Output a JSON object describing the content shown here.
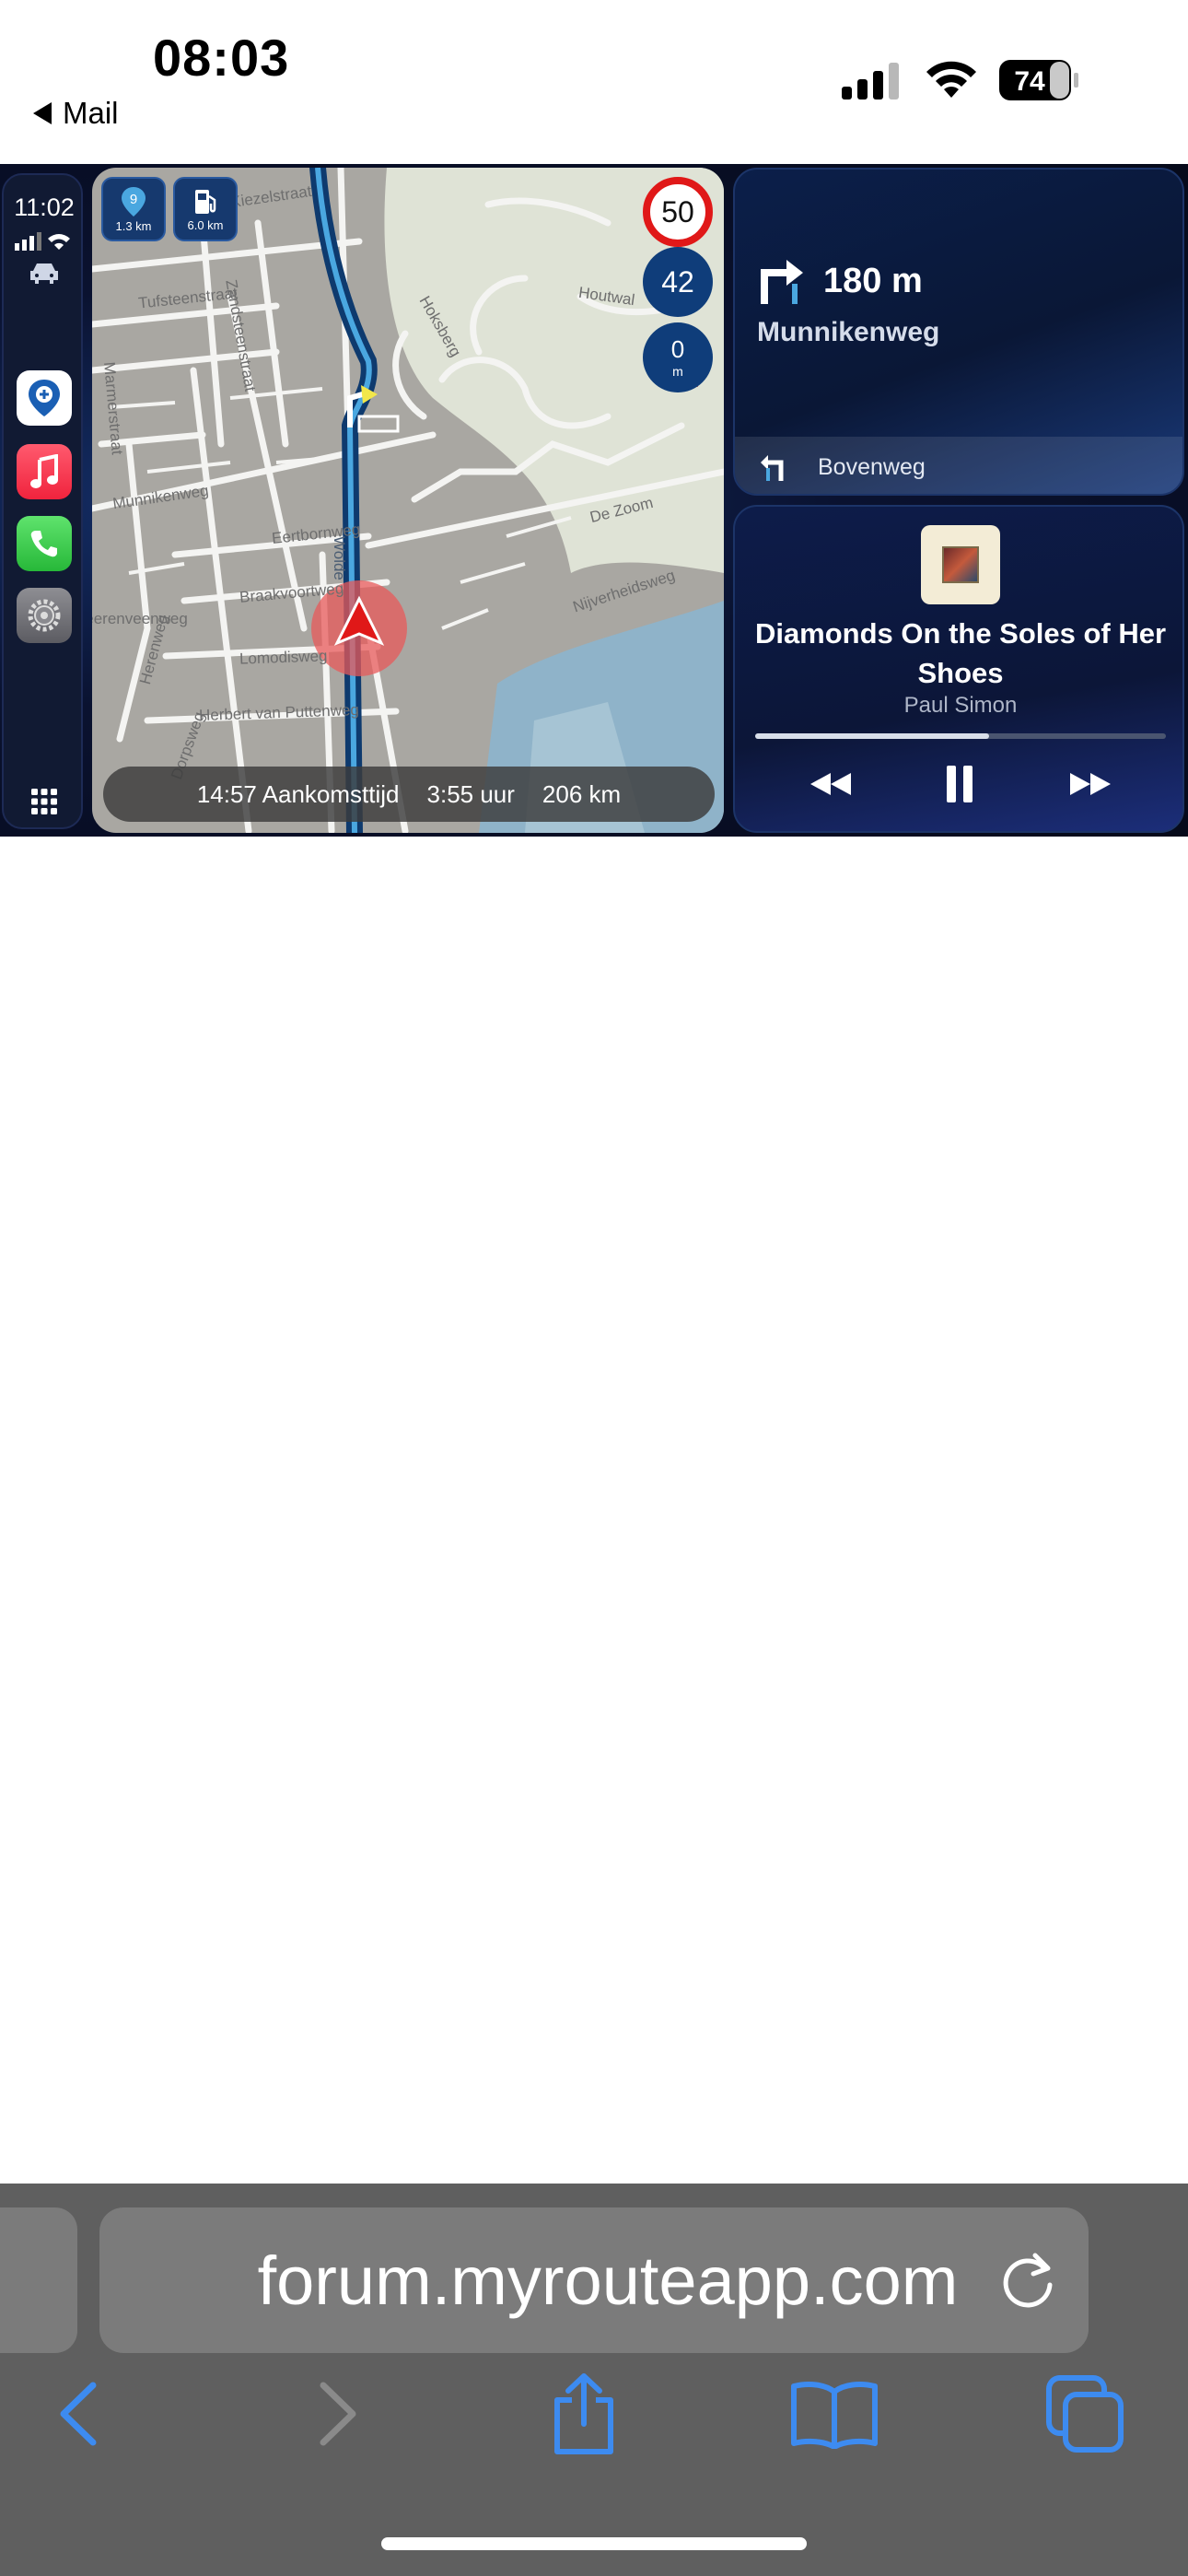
{
  "status_bar": {
    "time": "08:03",
    "back_label": "Mail",
    "battery": "74"
  },
  "carplay": {
    "dock": {
      "time": "11:02",
      "apps": [
        "maps-app-icon",
        "music-app-icon",
        "phone-app-icon",
        "settings-app-icon"
      ]
    },
    "map": {
      "poi_buttons": [
        {
          "number": "9",
          "distance": "1.3 km"
        },
        {
          "distance": "6.0 km"
        }
      ],
      "speed_limit": "50",
      "current_speed": "42",
      "distance_badge": {
        "value": "0",
        "unit": "m"
      },
      "streets": [
        "Kiezelstraat",
        "Tufsteenstraat",
        "Zandsteenstraat",
        "Marmerstraat",
        "Munnikenweg",
        "Eertbornweg",
        "Braakvoortweg",
        "Lomodisweg",
        "Herenweg",
        "Heerenveenweg",
        "Herbert van Puttenweg",
        "Dorpsweg",
        "Houtwal",
        "Hoksberg",
        "Wolde",
        "De Zoom",
        "Nijverheidsweg"
      ],
      "trip": {
        "arrival": "14:57 Aankomsttijd",
        "duration": "3:55 uur",
        "distance": "206 km"
      }
    },
    "navigation": {
      "distance": "180 m",
      "street": "Munnikenweg",
      "next_street": "Bovenweg"
    },
    "now_playing": {
      "title": "Diamonds On the Soles of Her Shoes",
      "artist": "Paul Simon",
      "progress": 0.57
    }
  },
  "safari": {
    "url": "forum.myrouteapp.com"
  }
}
